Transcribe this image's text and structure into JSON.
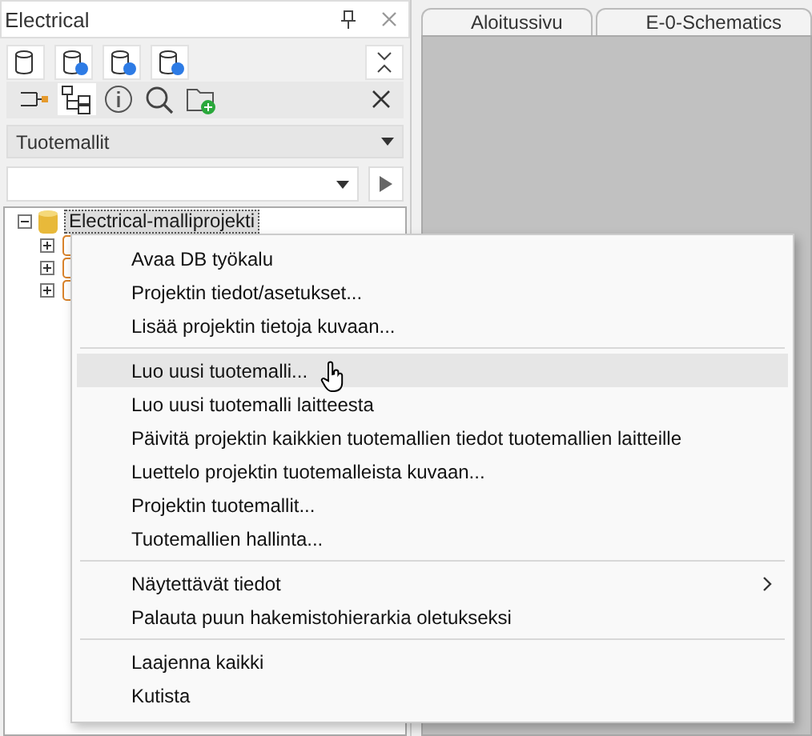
{
  "panel": {
    "title": "Electrical",
    "view_select": {
      "value": "Tuotemallit"
    },
    "tree": {
      "label": "Electrical-malliprojekti",
      "expanded": true,
      "selected": true,
      "children": [
        {
          "expanded": false
        },
        {
          "expanded": false
        },
        {
          "expanded": false
        }
      ]
    }
  },
  "tabs": [
    {
      "label": "Aloitussivu",
      "selected": false
    },
    {
      "label": "E-0-Schematics",
      "selected": false
    }
  ],
  "context_menu": {
    "sections": [
      [
        {
          "label": "Avaa DB työkalu",
          "selected": false,
          "submenu": false
        },
        {
          "label": "Projektin tiedot/asetukset...",
          "selected": false,
          "submenu": false
        },
        {
          "label": "Lisää projektin tietoja kuvaan...",
          "selected": false,
          "submenu": false
        }
      ],
      [
        {
          "label": "Luo uusi tuotemalli...",
          "selected": true,
          "submenu": false
        },
        {
          "label": "Luo uusi tuotemalli laitteesta",
          "selected": false,
          "submenu": false
        },
        {
          "label": "Päivitä projektin kaikkien tuotemallien tiedot tuotemallien laitteille",
          "selected": false,
          "submenu": false
        },
        {
          "label": "Luettelo projektin tuotemalleista kuvaan...",
          "selected": false,
          "submenu": false
        },
        {
          "label": "Projektin tuotemallit...",
          "selected": false,
          "submenu": false
        },
        {
          "label": "Tuotemallien hallinta...",
          "selected": false,
          "submenu": false
        }
      ],
      [
        {
          "label": "Näytettävät tiedot",
          "selected": false,
          "submenu": true
        },
        {
          "label": "Palauta puun hakemistohierarkia oletukseksi",
          "selected": false,
          "submenu": false
        }
      ],
      [
        {
          "label": "Laajenna kaikki",
          "selected": false,
          "submenu": false
        },
        {
          "label": "Kutista",
          "selected": false,
          "submenu": false
        }
      ]
    ]
  }
}
